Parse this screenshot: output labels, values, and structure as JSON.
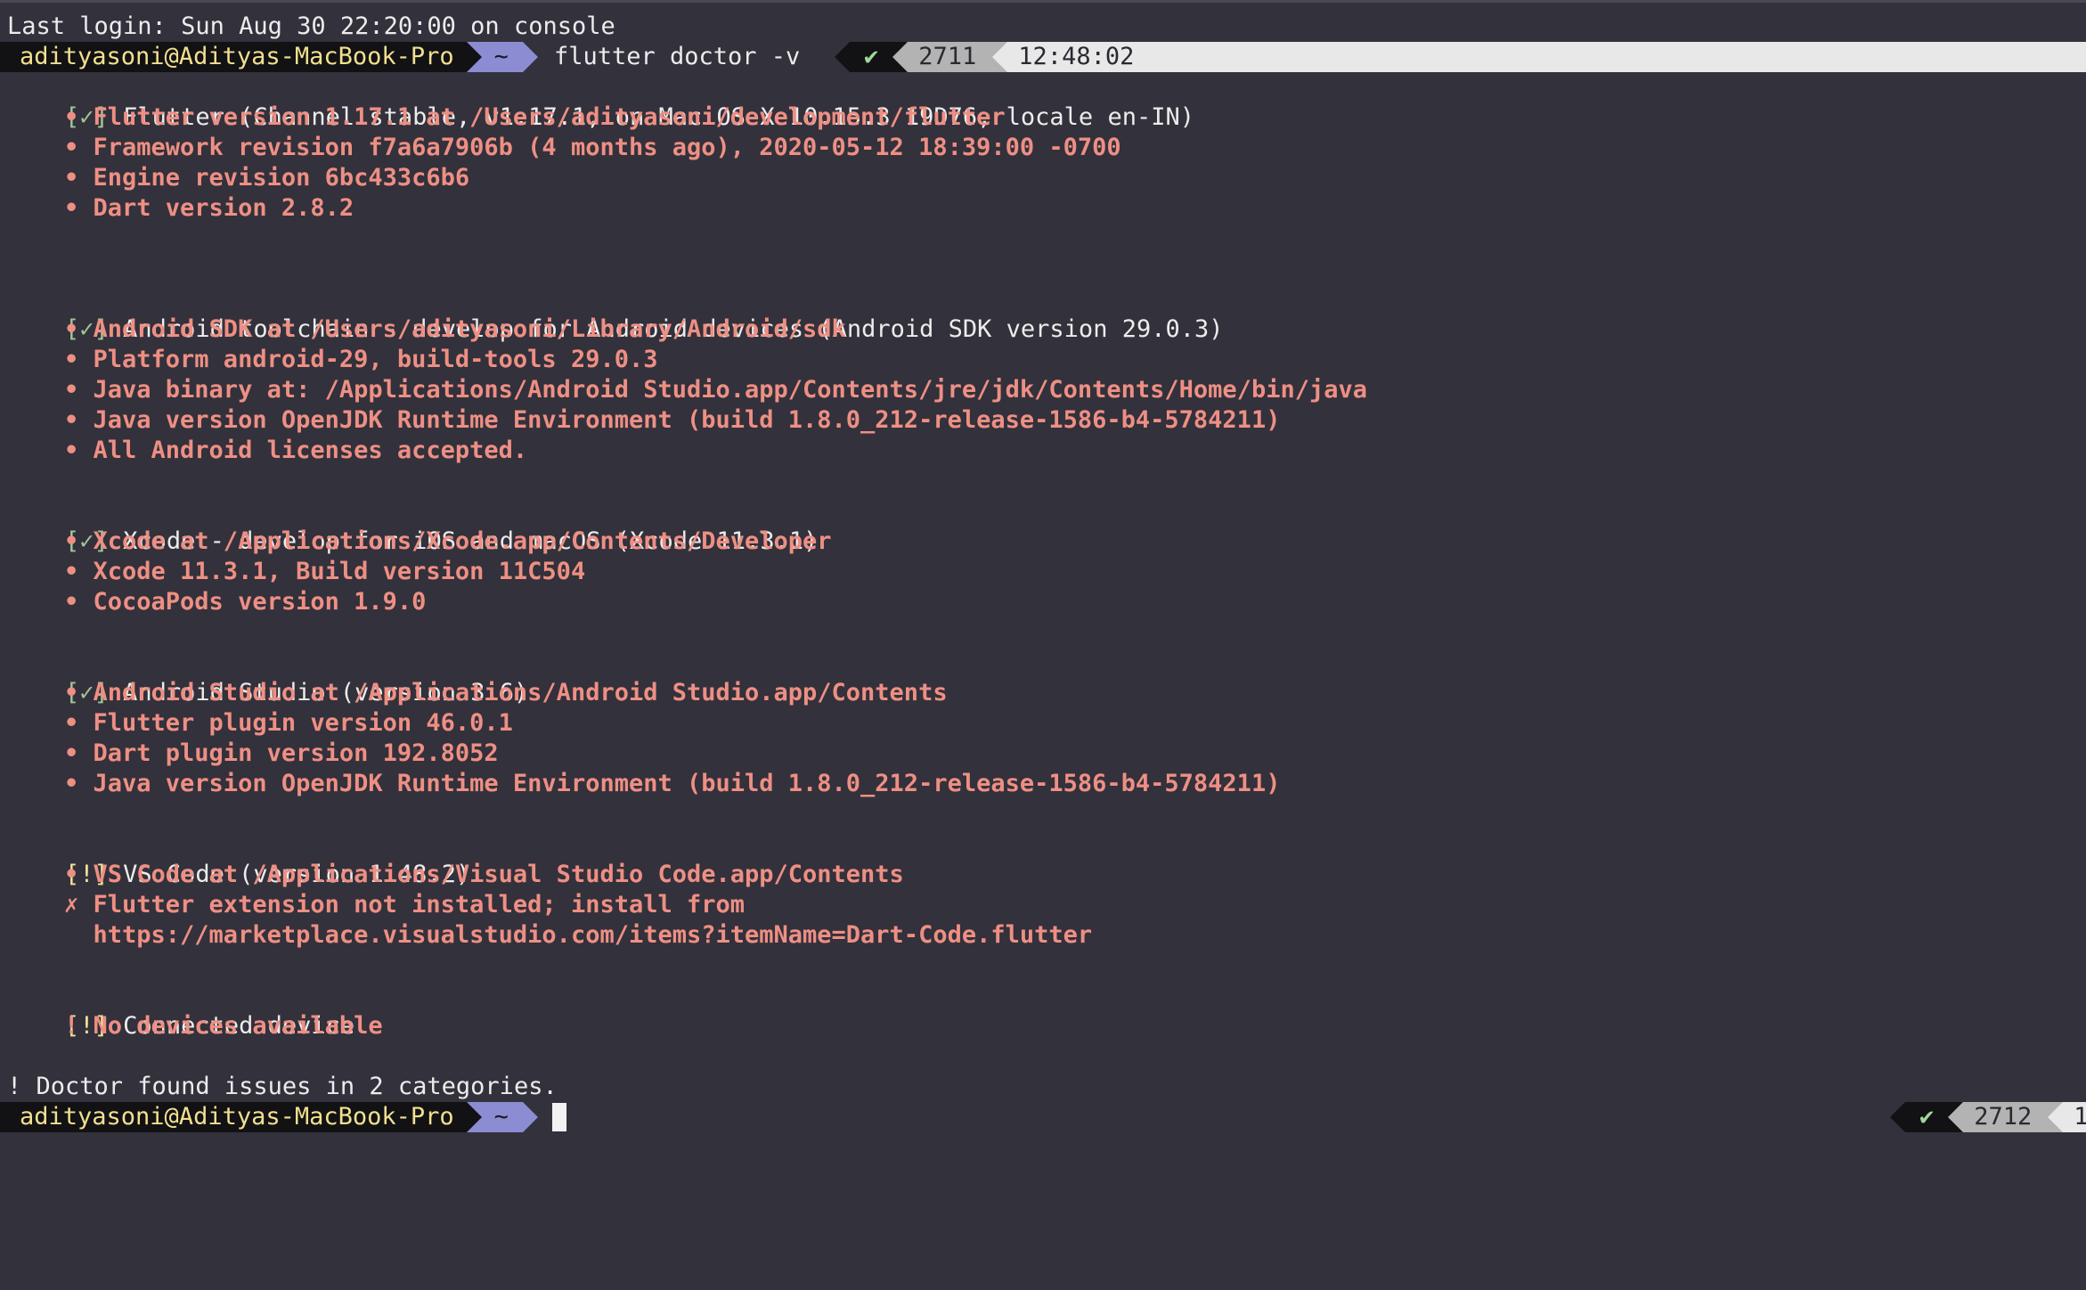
{
  "session": {
    "last_login": "Last login: Sun Aug 30 22:20:00 on console"
  },
  "prompt": {
    "user_host": "adityasoni@Adityas-MacBook-Pro",
    "directory": "~",
    "command": "flutter doctor -v",
    "status_icon": "✔",
    "history_number": "2711",
    "time": "12:48:02"
  },
  "prompt_final": {
    "user_host": "adityasoni@Adityas-MacBook-Pro",
    "directory": "~",
    "status_icon": "✔",
    "history_number": "2712",
    "time_partial": "1"
  },
  "sections": {
    "flutter": {
      "status": "[✓]",
      "title": "Flutter (Channel stable, v1.17.1, on Mac OS X 10.15.3 19D76, locale en-IN)",
      "details": [
        "• Flutter version 1.17.1 at /Users/adityasoni/development/flutter",
        "• Framework revision f7a6a7906b (4 months ago), 2020-05-12 18:39:00 -0700",
        "• Engine revision 6bc433c6b6",
        "• Dart version 2.8.2"
      ]
    },
    "android_toolchain": {
      "status": "[✓]",
      "title": "Android toolchain - develop for Android devices (Android SDK version 29.0.3)",
      "details": [
        "• Android SDK at /Users/adityasoni/Library/Android/sdk",
        "• Platform android-29, build-tools 29.0.3",
        "• Java binary at: /Applications/Android Studio.app/Contents/jre/jdk/Contents/Home/bin/java",
        "• Java version OpenJDK Runtime Environment (build 1.8.0_212-release-1586-b4-5784211)",
        "• All Android licenses accepted."
      ]
    },
    "xcode": {
      "status": "[✓]",
      "title": "Xcode - develop for iOS and macOS (Xcode 11.3.1)",
      "details": [
        "• Xcode at /Applications/Xcode.app/Contents/Developer",
        "• Xcode 11.3.1, Build version 11C504",
        "• CocoaPods version 1.9.0"
      ]
    },
    "android_studio": {
      "status": "[✓]",
      "title": "Android Studio (version 3.6)",
      "details": [
        "• Android Studio at /Applications/Android Studio.app/Contents",
        "• Flutter plugin version 46.0.1",
        "• Dart plugin version 192.8052",
        "• Java version OpenJDK Runtime Environment (build 1.8.0_212-release-1586-b4-5784211)"
      ]
    },
    "vscode": {
      "status": "[!]",
      "title": "VS Code (version 1.48.2)",
      "details": [
        "• VS Code at /Applications/Visual Studio Code.app/Contents",
        "✗ Flutter extension not installed; install from",
        "  https://marketplace.visualstudio.com/items?itemName=Dart-Code.flutter"
      ]
    },
    "connected_device": {
      "status": "[!]",
      "title": "Connected device",
      "details": [
        "! No devices available"
      ]
    }
  },
  "summary": "! Doctor found issues in 2 categories."
}
